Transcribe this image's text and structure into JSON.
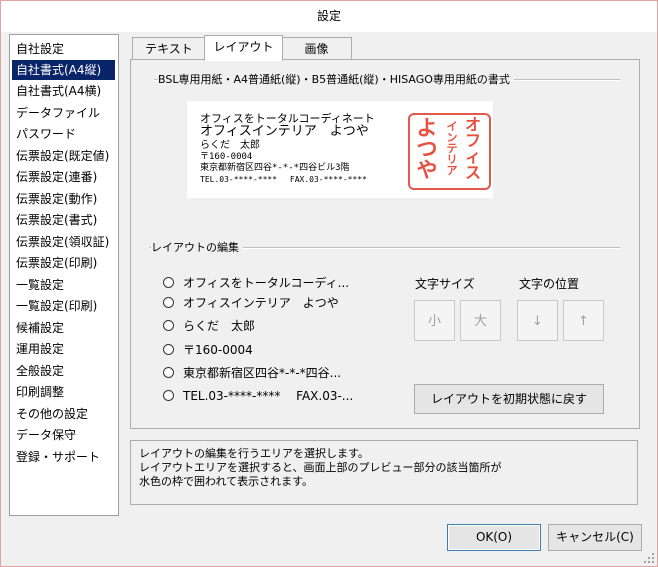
{
  "window": {
    "title": "設定"
  },
  "sidebar": {
    "items": [
      {
        "label": "自社設定",
        "selected": false
      },
      {
        "label": "自社書式(A4縦)",
        "selected": true
      },
      {
        "label": "自社書式(A4横)",
        "selected": false
      },
      {
        "label": "データファイル",
        "selected": false
      },
      {
        "label": "パスワード",
        "selected": false
      },
      {
        "label": "伝票設定(既定値)",
        "selected": false
      },
      {
        "label": "伝票設定(連番)",
        "selected": false
      },
      {
        "label": "伝票設定(動作)",
        "selected": false
      },
      {
        "label": "伝票設定(書式)",
        "selected": false
      },
      {
        "label": "伝票設定(領収証)",
        "selected": false
      },
      {
        "label": "伝票設定(印刷)",
        "selected": false
      },
      {
        "label": "一覧設定",
        "selected": false
      },
      {
        "label": "一覧設定(印刷)",
        "selected": false
      },
      {
        "label": "候補設定",
        "selected": false
      },
      {
        "label": "運用設定",
        "selected": false
      },
      {
        "label": "全般設定",
        "selected": false
      },
      {
        "label": "印刷調整",
        "selected": false
      },
      {
        "label": "その他の設定",
        "selected": false
      },
      {
        "label": "データ保守",
        "selected": false
      },
      {
        "label": "登録・サポート",
        "selected": false
      }
    ]
  },
  "tabs": [
    {
      "label": "テキスト",
      "active": false
    },
    {
      "label": "レイアウト",
      "active": true
    },
    {
      "label": "画像",
      "active": false
    }
  ],
  "paper_section": {
    "title": "BSL専用用紙・A4普通紙(縦)・B5普通紙(縦)・HISAGO専用用紙の書式"
  },
  "preview": {
    "lines": [
      "オフィスをトータルコーディネート",
      "オフィスインテリア　よつや",
      "らくだ　太郎",
      "〒160-0004",
      "東京都新宿区四谷*-*-*四谷ビル3階",
      "TEL.03-****-****　 FAX.03-****-****"
    ],
    "stamp": {
      "columns": [
        "オフィス",
        "インテリア",
        "よつや"
      ],
      "color": "#e8503f"
    }
  },
  "layout_section": {
    "title": "レイアウトの編集",
    "options": [
      "オフィスをトータルコーディ...",
      "オフィスインテリア　よつや",
      "らくだ　太郎",
      "〒160-0004",
      "東京都新宿区四谷*-*-*四谷...",
      "TEL.03-****-****　 FAX.03-..."
    ],
    "font_size": {
      "label": "文字サイズ",
      "small": "小",
      "large": "大"
    },
    "position": {
      "label": "文字の位置",
      "down": "↓",
      "up": "↑"
    },
    "reset_label": "レイアウトを初期状態に戻す"
  },
  "info": {
    "lines": [
      "レイアウトの編集を行うエリアを選択します。",
      "レイアウトエリアを選択すると、画面上部のプレビュー部分の該当箇所が",
      "水色の枠で囲われて表示されます。"
    ]
  },
  "buttons": {
    "ok": "OK(O)",
    "cancel": "キャンセル(C)"
  },
  "colors": {
    "selection": "#0a246a",
    "stamp": "#e8503f",
    "default_border": "#3c7fb1"
  }
}
